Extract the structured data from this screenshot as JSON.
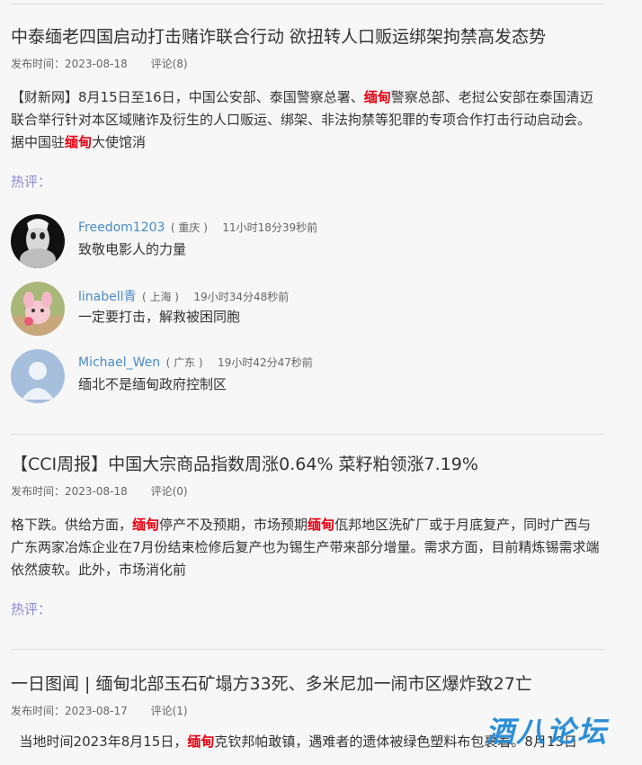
{
  "articles": [
    {
      "title": "中泰缅老四国启动打击赌诈联合行动 欲扭转人口贩运绑架拘禁高发态势",
      "date": "发布时间：2023-08-18",
      "comments": "评论(8)",
      "summary": [
        {
          "t": "【财新网】8月15日至16日，中国公安部、泰国警察总署、"
        },
        {
          "t": "缅甸",
          "hl": true
        },
        {
          "t": "警察总部、老挝公安部在泰国清迈联合举行针对本区域赌诈及衍生的人口贩运、绑架、非法拘禁等犯罪的专项合作打击行动启动会。 据中国驻"
        },
        {
          "t": "缅甸",
          "hl": true
        },
        {
          "t": "大使馆消"
        }
      ],
      "hot_label": "热评：",
      "hot_comments": [
        {
          "user": "Freedom1203",
          "location": "( 重庆 )",
          "time": "11小时18分39秒前",
          "text": "致敬电影人的力量",
          "avatar": "freedom"
        },
        {
          "user": "linabell青",
          "location": "( 上海 )",
          "time": "19小时34分48秒前",
          "text": "一定要打击，解救被困同胞",
          "avatar": "linabell"
        },
        {
          "user": "Michael_Wen",
          "location": "( 广东 )",
          "time": "19小时42分47秒前",
          "text": "缅北不是缅甸政府控制区",
          "avatar": "default-user"
        }
      ]
    },
    {
      "title": "【CCI周报】中国大宗商品指数周涨0.64% 菜籽粕领涨7.19%",
      "date": "发布时间：2023-08-18",
      "comments": "评论(0)",
      "summary": [
        {
          "t": "格下跌。供给方面，"
        },
        {
          "t": "缅甸",
          "hl": true
        },
        {
          "t": "停产不及预期，市场预期"
        },
        {
          "t": "缅甸",
          "hl": true
        },
        {
          "t": "佤邦地区洗矿厂或于月底复产，同时广西与广东两家冶炼企业在7月份结束检修后复产也为锡生产带来部分增量。需求方面，目前精炼锡需求端依然疲软。此外，市场消化前"
        }
      ],
      "hot_label": "热评："
    },
    {
      "title": "一日图闻 | 缅甸北部玉石矿塌方33死、多米尼加一闹市区爆炸致27亡",
      "date": "发布时间：2023-08-17",
      "comments": "评论(1)",
      "summary": [
        {
          "t": "  当地时间2023年8月15日，"
        },
        {
          "t": "缅甸",
          "hl": true
        },
        {
          "t": "克钦邦帕敢镇，遇难者的遗体被绿色塑料布包裹着。8月13日"
        }
      ]
    }
  ],
  "watermark": "酒八论坛"
}
